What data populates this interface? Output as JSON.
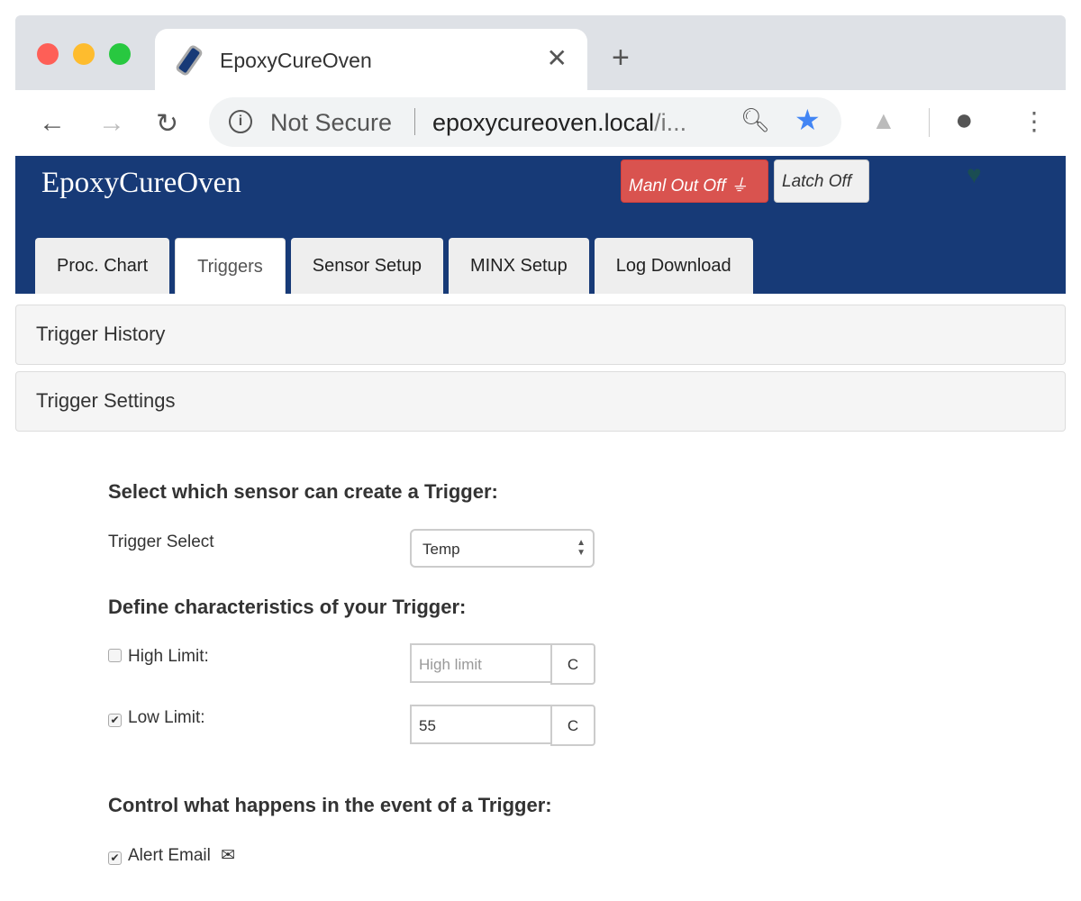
{
  "browser": {
    "tab_title": "EpoxyCureOven",
    "not_secure": "Not Secure",
    "url_main": "epoxycureoven.local",
    "url_rest": "/i..."
  },
  "navbar": {
    "brand": "EpoxyCureOven",
    "manual_out": "Manl Out Off",
    "latch": "Latch Off"
  },
  "tabs": [
    {
      "label": "Proc. Chart"
    },
    {
      "label": "Triggers",
      "active": true
    },
    {
      "label": "Sensor Setup"
    },
    {
      "label": "MINX Setup"
    },
    {
      "label": "Log Download"
    }
  ],
  "panels": {
    "history": "Trigger History",
    "settings": "Trigger Settings"
  },
  "form": {
    "h_select": "Select which sensor can create a Trigger:",
    "trigger_select_label": "Trigger Select",
    "trigger_select_value": "Temp",
    "h_define": "Define characteristics of your Trigger:",
    "high_label": "High Limit:",
    "high_checked": false,
    "high_placeholder": "High limit",
    "high_unit": "C",
    "low_label": "Low Limit:",
    "low_checked": true,
    "low_value": "55",
    "low_unit": "C",
    "h_control": "Control what happens in the event of a Trigger:",
    "alert_label": "Alert Email",
    "alert_checked": true
  },
  "colors": {
    "navbar": "#173a77",
    "danger": "#d9534f"
  }
}
